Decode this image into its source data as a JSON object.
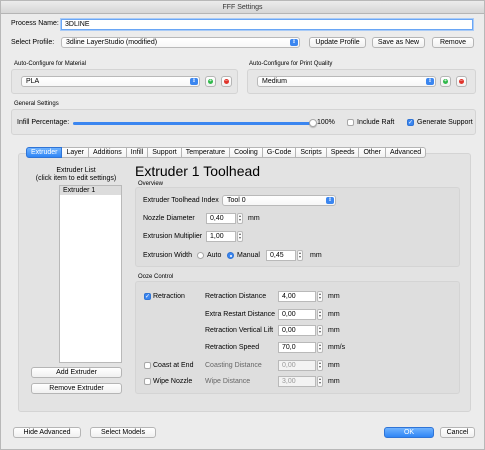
{
  "window": {
    "title": "FFF Settings"
  },
  "process": {
    "name_label": "Process Name:",
    "name_value": "3DLINE",
    "profile_label": "Select Profile:",
    "profile_value": "3dline LayerStudio (modified)",
    "update_btn": "Update Profile",
    "save_as_btn": "Save as New",
    "remove_btn": "Remove"
  },
  "material": {
    "title": "Auto-Configure for Material",
    "value": "PLA"
  },
  "quality": {
    "title": "Auto-Configure for Print Quality",
    "value": "Medium"
  },
  "general": {
    "title": "General Settings",
    "infill_label": "Infill Percentage:",
    "infill_value": "100%",
    "infill_fraction": 1.0,
    "raft_label": "Include Raft",
    "raft_checked": false,
    "support_label": "Generate Support",
    "support_checked": true
  },
  "tabs": [
    "Extruder",
    "Layer",
    "Additions",
    "Infill",
    "Support",
    "Temperature",
    "Cooling",
    "G-Code",
    "Scripts",
    "Speeds",
    "Other",
    "Advanced"
  ],
  "active_tab": "Extruder",
  "extruder_list": {
    "title_line1": "Extruder List",
    "title_line2": "(click item to edit settings)",
    "items": [
      "Extruder 1"
    ],
    "add_btn": "Add Extruder",
    "remove_btn": "Remove Extruder"
  },
  "extruder": {
    "heading": "Extruder 1 Toolhead",
    "overview_title": "Overview",
    "toolhead_label": "Extruder Toolhead Index",
    "toolhead_value": "Tool 0",
    "nozzle_label": "Nozzle Diameter",
    "nozzle_value": "0,40",
    "nozzle_unit": "mm",
    "mult_label": "Extrusion Multiplier",
    "mult_value": "1,00",
    "width_label": "Extrusion Width",
    "width_auto": "Auto",
    "width_manual": "Manual",
    "width_value": "0,45",
    "width_unit": "mm"
  },
  "ooze": {
    "title": "Ooze Control",
    "retraction_label": "Retraction",
    "retraction_checked": true,
    "coast_label": "Coast at End",
    "coast_checked": false,
    "wipe_label": "Wipe Nozzle",
    "wipe_checked": false,
    "rows": [
      {
        "label": "Retraction Distance",
        "value": "4,00",
        "unit": "mm",
        "disabled": false
      },
      {
        "label": "Extra Restart Distance",
        "value": "0,00",
        "unit": "mm",
        "disabled": false
      },
      {
        "label": "Retraction Vertical Lift",
        "value": "0,00",
        "unit": "mm",
        "disabled": false
      },
      {
        "label": "Retraction Speed",
        "value": "70,0",
        "unit": "mm/s",
        "disabled": false
      },
      {
        "label": "Coasting Distance",
        "value": "0,00",
        "unit": "mm",
        "disabled": true
      },
      {
        "label": "Wipe Distance",
        "value": "3,00",
        "unit": "mm",
        "disabled": true
      }
    ]
  },
  "footer": {
    "hide_adv": "Hide Advanced",
    "select_models": "Select Models",
    "ok": "OK",
    "cancel": "Cancel"
  },
  "colors": {
    "accent": "#3b86f0",
    "add": "#2fb84a",
    "remove": "#e0332a"
  }
}
